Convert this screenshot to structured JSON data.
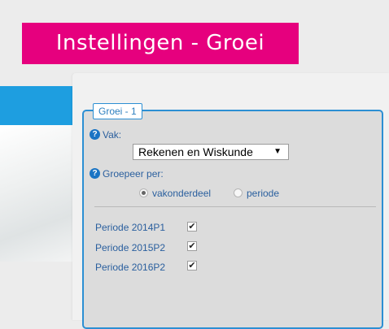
{
  "header": {
    "title": "Instellingen - Groei"
  },
  "panel": {
    "legend": "Groei - 1",
    "vak": {
      "label": "Vak:",
      "selected": "Rekenen en Wiskunde",
      "caret": "▼"
    },
    "group_by": {
      "label": "Groepeer per:",
      "options": [
        {
          "label": "vakonderdeel",
          "checked": true
        },
        {
          "label": "periode",
          "checked": false
        }
      ]
    },
    "periods": [
      {
        "label": "Periode 2014P1",
        "checked": true
      },
      {
        "label": "Periode 2015P2",
        "checked": true
      },
      {
        "label": "Periode 2016P2",
        "checked": true
      }
    ],
    "help_glyph": "?",
    "check_glyph": "✔"
  },
  "colors": {
    "accent_pink": "#e6007e",
    "accent_blue": "#2c8fd3",
    "label_blue": "#2a5f9e"
  },
  "icons": {
    "help": "help-icon",
    "check": "checkmark-icon",
    "dropdown": "chevron-down-icon"
  }
}
